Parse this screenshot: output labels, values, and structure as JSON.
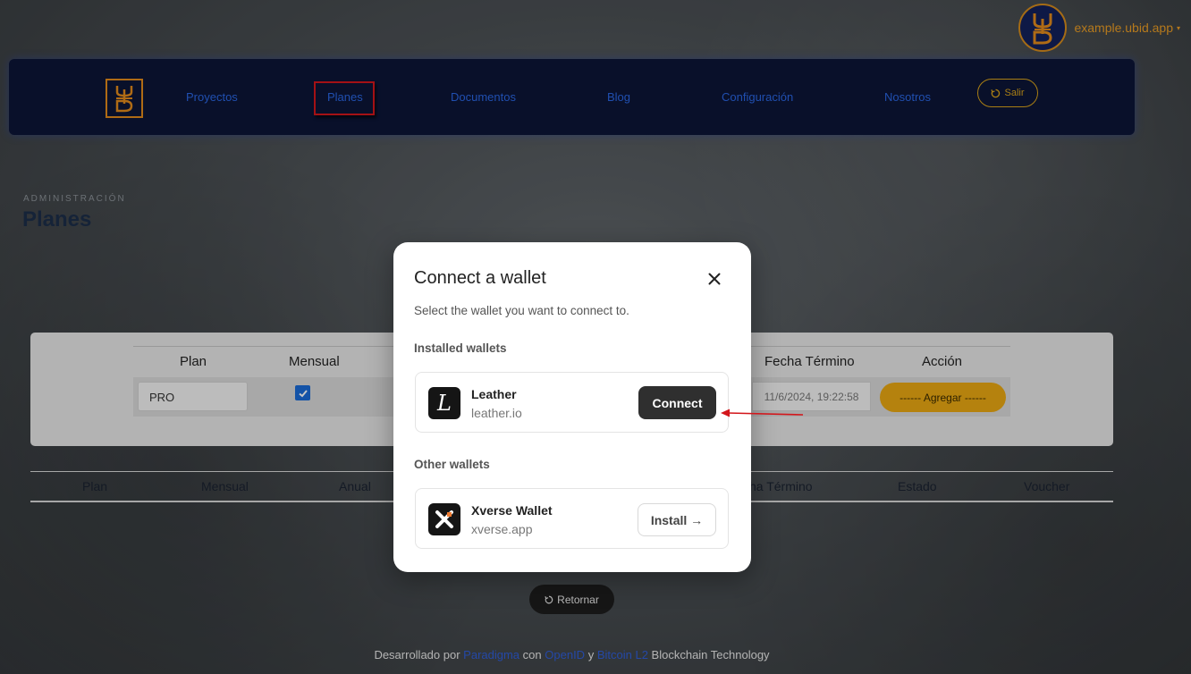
{
  "account": {
    "name": "example.ubid.app",
    "caret": "▾"
  },
  "nav": {
    "items": [
      "Proyectos",
      "Planes",
      "Documentos",
      "Blog",
      "Configuración",
      "Nosotros"
    ],
    "active": "Planes",
    "logout_label": "Salir"
  },
  "page": {
    "kicker": "ADMINISTRACIÓN",
    "title": "Planes"
  },
  "plan_table": {
    "headers": [
      "Plan",
      "Mensual",
      "Fecha Término",
      "Acción"
    ],
    "row": {
      "plan": "PRO",
      "mensual_checked": true,
      "fecha_termino": "11/6/2024, 19:22:58",
      "action_label": "------ Agregar ------"
    }
  },
  "list_table": {
    "headers": [
      "Plan",
      "Mensual",
      "Anual",
      "cha Término",
      "Estado",
      "Voucher"
    ]
  },
  "return_label": "Retornar",
  "footer": {
    "prefix": "Desarrollado por",
    "link1": "Paradigma",
    "con": "con",
    "link2": "OpenID",
    "y": "y",
    "link3": "Bitcoin L2",
    "suffix": "Blockchain Technology"
  },
  "modal": {
    "title": "Connect a wallet",
    "subtitle": "Select the wallet you want to connect to.",
    "installed_label": "Installed wallets",
    "other_label": "Other wallets",
    "installed": [
      {
        "name": "Leather",
        "domain": "leather.io",
        "action": "Connect",
        "icon": "leather-icon"
      }
    ],
    "other": [
      {
        "name": "Xverse Wallet",
        "domain": "xverse.app",
        "action": "Install →",
        "icon": "xverse-icon"
      }
    ]
  },
  "colors": {
    "accent_orange": "#e8a712",
    "nav_bg": "#0c1536",
    "link_blue": "#2a66e2",
    "highlight_red": "#d3161b"
  }
}
